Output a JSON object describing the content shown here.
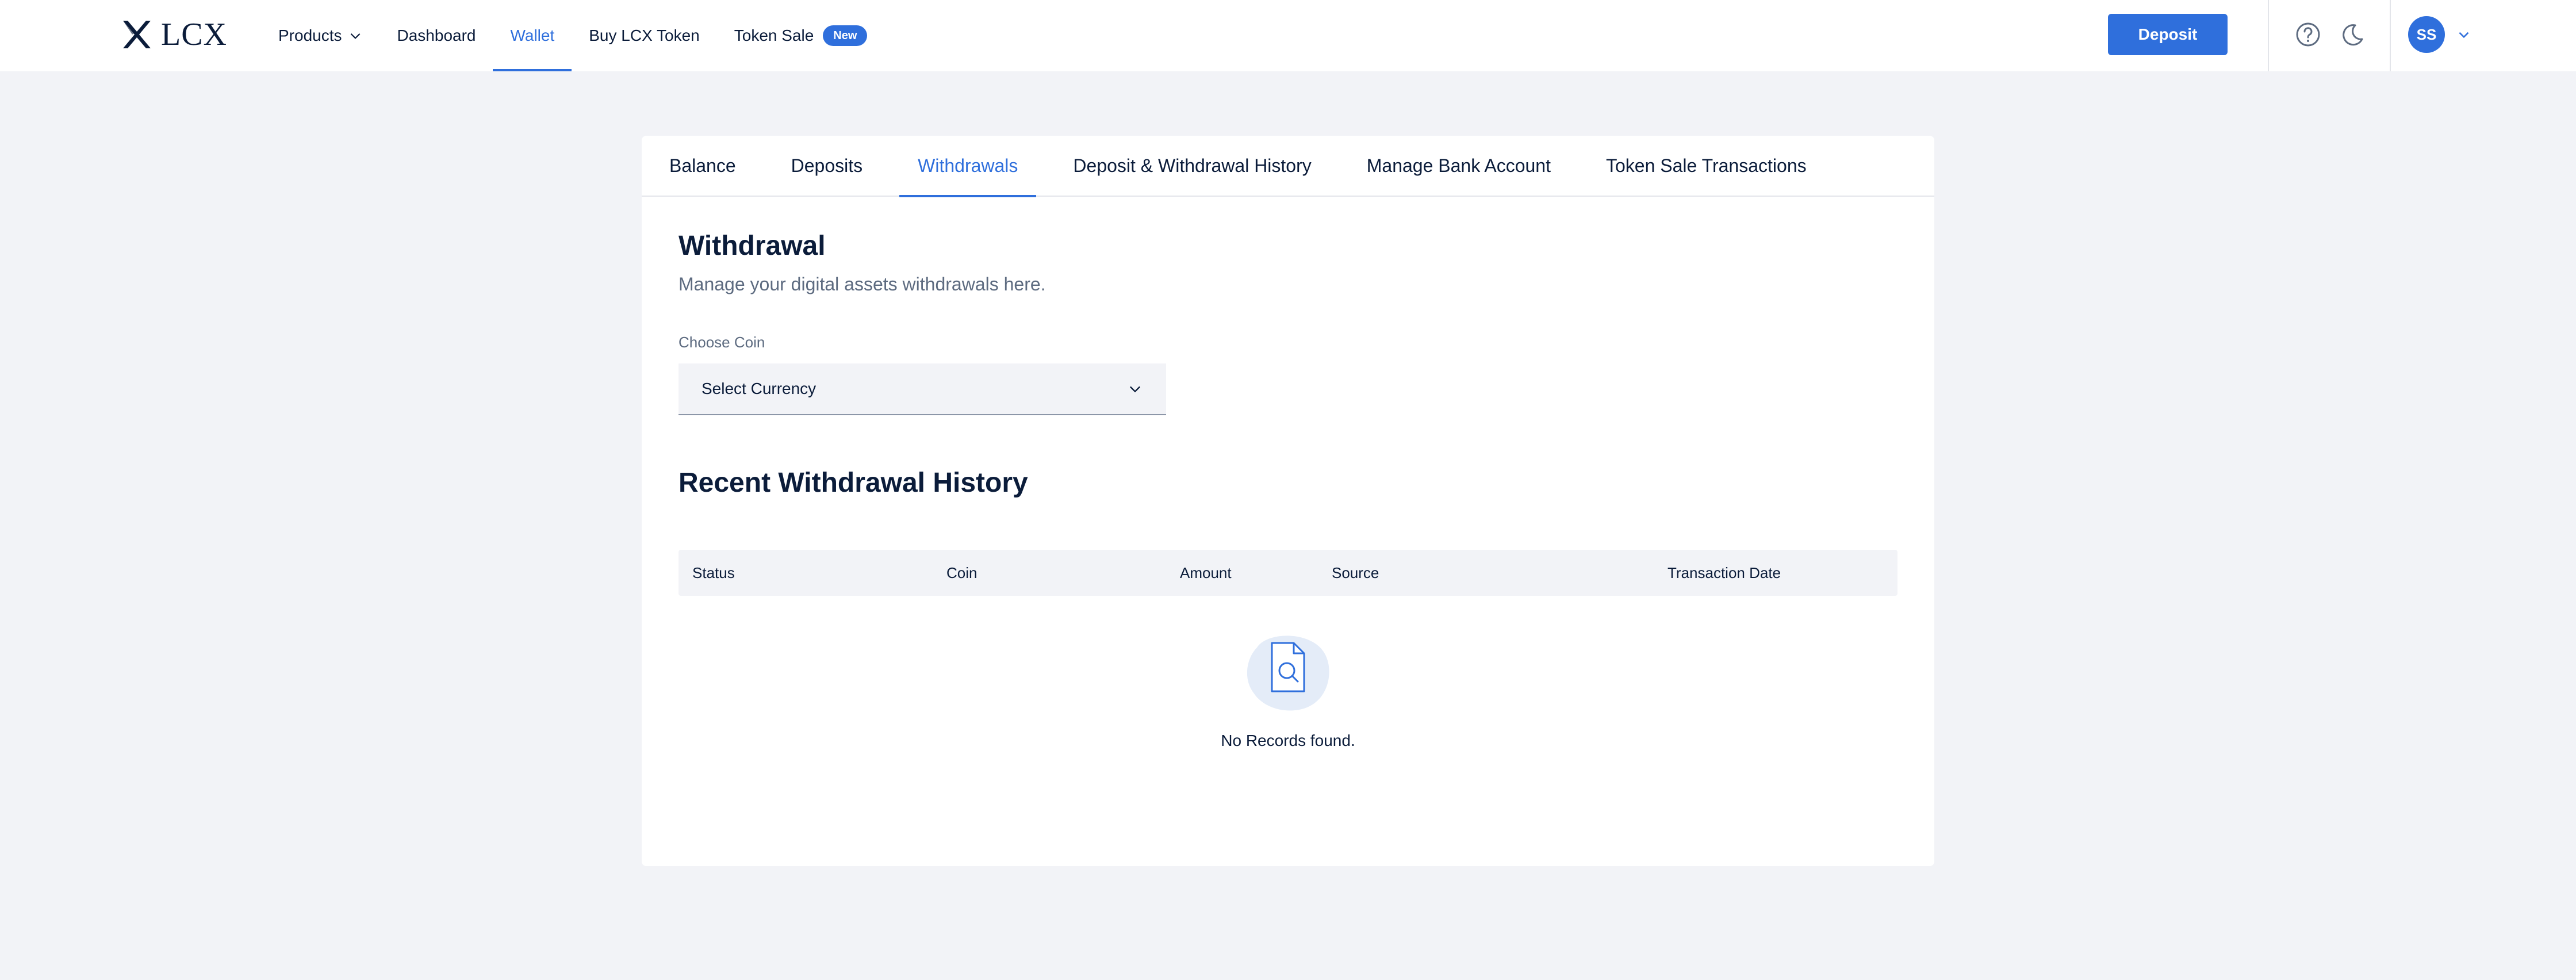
{
  "brand": {
    "name": "LCX",
    "logo_icon": "lcx-x-logo-icon"
  },
  "nav": {
    "items": [
      {
        "label": "Products",
        "has_dropdown": true
      },
      {
        "label": "Dashboard"
      },
      {
        "label": "Wallet",
        "active": true
      },
      {
        "label": "Buy LCX Token"
      },
      {
        "label": "Token Sale",
        "badge": "New"
      }
    ]
  },
  "header": {
    "deposit_label": "Deposit",
    "help_icon": "help-circle-icon",
    "theme_icon": "moon-icon",
    "avatar_initials": "SS"
  },
  "tabs": [
    {
      "label": "Balance"
    },
    {
      "label": "Deposits"
    },
    {
      "label": "Withdrawals",
      "active": true
    },
    {
      "label": "Deposit & Withdrawal History"
    },
    {
      "label": "Manage Bank Account"
    },
    {
      "label": "Token Sale Transactions"
    }
  ],
  "withdrawal": {
    "title": "Withdrawal",
    "subtitle": "Manage your digital assets withdrawals here.",
    "choose_coin_label": "Choose Coin",
    "select_value": "Select Currency"
  },
  "history": {
    "title": "Recent Withdrawal History",
    "columns": [
      "Status",
      "Coin",
      "Amount",
      "Source",
      "Transaction Date"
    ],
    "empty_text": "No Records found.",
    "empty_icon": "document-search-icon"
  },
  "colors": {
    "accent": "#2f6fdc",
    "background": "#f2f3f7",
    "text": "#0b1c3a",
    "muted": "#5d6b80"
  }
}
